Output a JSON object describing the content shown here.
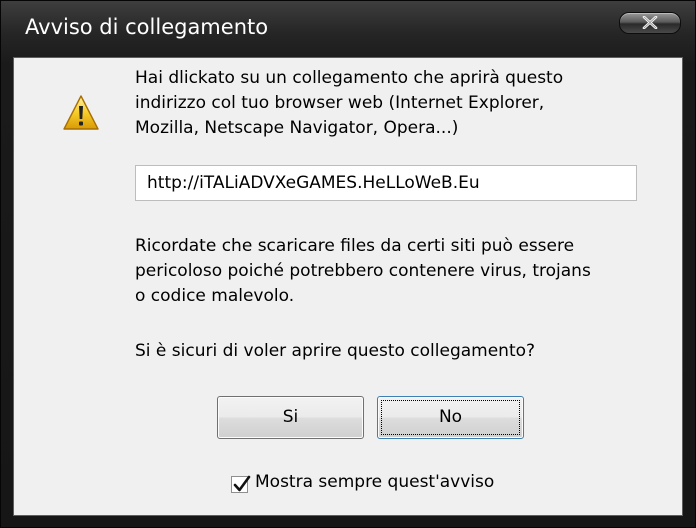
{
  "window": {
    "title": "Avviso di collegamento"
  },
  "message": {
    "line1": "Hai dlickato su un collegamento che aprirà questo",
    "line2": "indirizzo col tuo browser web (Internet Explorer,",
    "line3": "Mozilla, Netscape Navigator, Opera...)",
    "warning1": "Ricordate che scaricare files da certi siti può essere",
    "warning2": "pericoloso poiché potrebbero contenere virus, trojans",
    "warning3": "o codice malevolo.",
    "question": "Si è sicuri di voler aprire questo collegamento?"
  },
  "url_field": {
    "value": "http://iTALiADVXeGAMES.HeLLoWeB.Eu"
  },
  "buttons": {
    "yes_label": "Si",
    "no_label": "No"
  },
  "checkbox": {
    "label": "Mostra sempre quest'avviso",
    "checked": true
  },
  "icons": {
    "warning": "warning-icon",
    "close": "close-icon",
    "check": "check-icon"
  },
  "colors": {
    "titlebar": "#1a1a1a",
    "client_background": "#f0f0f0",
    "warning_yellow": "#f4c20d"
  }
}
